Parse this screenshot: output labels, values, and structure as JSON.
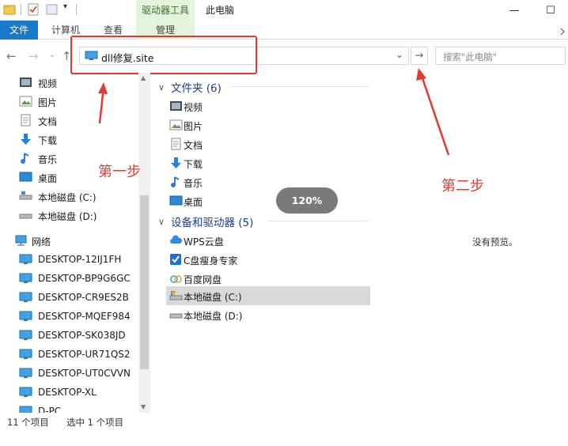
{
  "titlebar": {
    "context_tab": "驱动器工具",
    "window_title": "此电脑",
    "minimize": "—",
    "maximize": "☐"
  },
  "ribbon": {
    "file_tab": "文件",
    "tabs": [
      "计算机",
      "查看"
    ],
    "manage_tab": "管理"
  },
  "address": {
    "path": "dll修复.site",
    "search_placeholder": "搜索\"此电脑\""
  },
  "annotations": {
    "step1": "第一步",
    "step2": "第二步"
  },
  "nav": {
    "quick_items": [
      {
        "label": "视频",
        "icon": "video-icon"
      },
      {
        "label": "图片",
        "icon": "picture-icon"
      },
      {
        "label": "文档",
        "icon": "document-icon"
      },
      {
        "label": "下载",
        "icon": "download-icon"
      },
      {
        "label": "音乐",
        "icon": "music-icon"
      },
      {
        "label": "桌面",
        "icon": "desktop-icon"
      },
      {
        "label": "本地磁盘 (C:)",
        "icon": "drive-icon"
      },
      {
        "label": "本地磁盘 (D:)",
        "icon": "drive-icon"
      }
    ],
    "network_label": "网络",
    "network_items": [
      "DESKTOP-12IJ1FH",
      "DESKTOP-BP9G6GC",
      "DESKTOP-CR9ES2B",
      "DESKTOP-MQEF984",
      "DESKTOP-SK038JD",
      "DESKTOP-UR71QS2",
      "DESKTOP-UT0CVVN",
      "DESKTOP-XL",
      "D-PC"
    ]
  },
  "content": {
    "folders_header": "文件夹 (6)",
    "folders": [
      {
        "label": "视频",
        "icon": "video-icon"
      },
      {
        "label": "图片",
        "icon": "picture-icon"
      },
      {
        "label": "文档",
        "icon": "document-icon"
      },
      {
        "label": "下载",
        "icon": "download-icon"
      },
      {
        "label": "音乐",
        "icon": "music-icon"
      },
      {
        "label": "桌面",
        "icon": "desktop-icon"
      }
    ],
    "devices_header": "设备和驱动器 (5)",
    "devices": [
      {
        "label": "WPS云盘",
        "icon": "cloud-icon"
      },
      {
        "label": "C盘瘦身专家",
        "icon": "checkbox-app-icon"
      },
      {
        "label": "百度网盘",
        "icon": "baidu-netdisk-icon"
      },
      {
        "label": "本地磁盘 (C:)",
        "icon": "system-drive-icon",
        "selected": true
      },
      {
        "label": "本地磁盘 (D:)",
        "icon": "drive-icon"
      }
    ],
    "zoom": "120%",
    "preview_text": "没有预览。"
  },
  "status": {
    "count": "11 个项目",
    "selection": "选中 1 个项目"
  },
  "colors": {
    "accent": "#1979ca",
    "annotation": "#e03a33",
    "context_tab_bg": "#e4f4dc",
    "group_header": "#1e3e8f"
  }
}
